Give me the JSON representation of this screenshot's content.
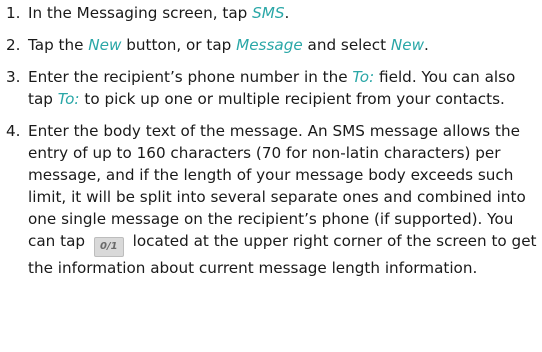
{
  "steps": [
    {
      "number": "1.",
      "parts": [
        {
          "text": "In the Messaging screen, tap "
        },
        {
          "text": "SMS",
          "highlight": true
        },
        {
          "text": "."
        }
      ]
    },
    {
      "number": "2.",
      "parts": [
        {
          "text": "Tap the "
        },
        {
          "text": "New",
          "highlight": true
        },
        {
          "text": " button, or tap "
        },
        {
          "text": "Message",
          "highlight": true
        },
        {
          "text": " and select "
        },
        {
          "text": "New",
          "highlight": true
        },
        {
          "text": "."
        }
      ]
    },
    {
      "number": "3.",
      "parts": [
        {
          "text": "Enter the recipient’s phone number in the "
        },
        {
          "text": "To:",
          "highlight": true
        },
        {
          "text": " field. You can also tap "
        },
        {
          "text": "To:",
          "highlight": true
        },
        {
          "text": " to pick up one or multiple recipient from your contacts."
        }
      ]
    },
    {
      "number": "4.",
      "parts": [
        {
          "text": "Enter the body text of the message. An SMS message allows the entry of up to 160 characters (70 for non-latin characters) per message, and if the length of your message body exceeds such limit, it will be split into several separate ones and combined into one single message on the recipient’s phone (if supported). You can tap "
        },
        {
          "badge": "0/1"
        },
        {
          "text": " located at the upper right corner of the screen to get the information about current message length information."
        }
      ]
    }
  ],
  "colors": {
    "highlight": "#2aa7a7",
    "text": "#1a1a1a",
    "badge_background": "#d9d9d9"
  }
}
